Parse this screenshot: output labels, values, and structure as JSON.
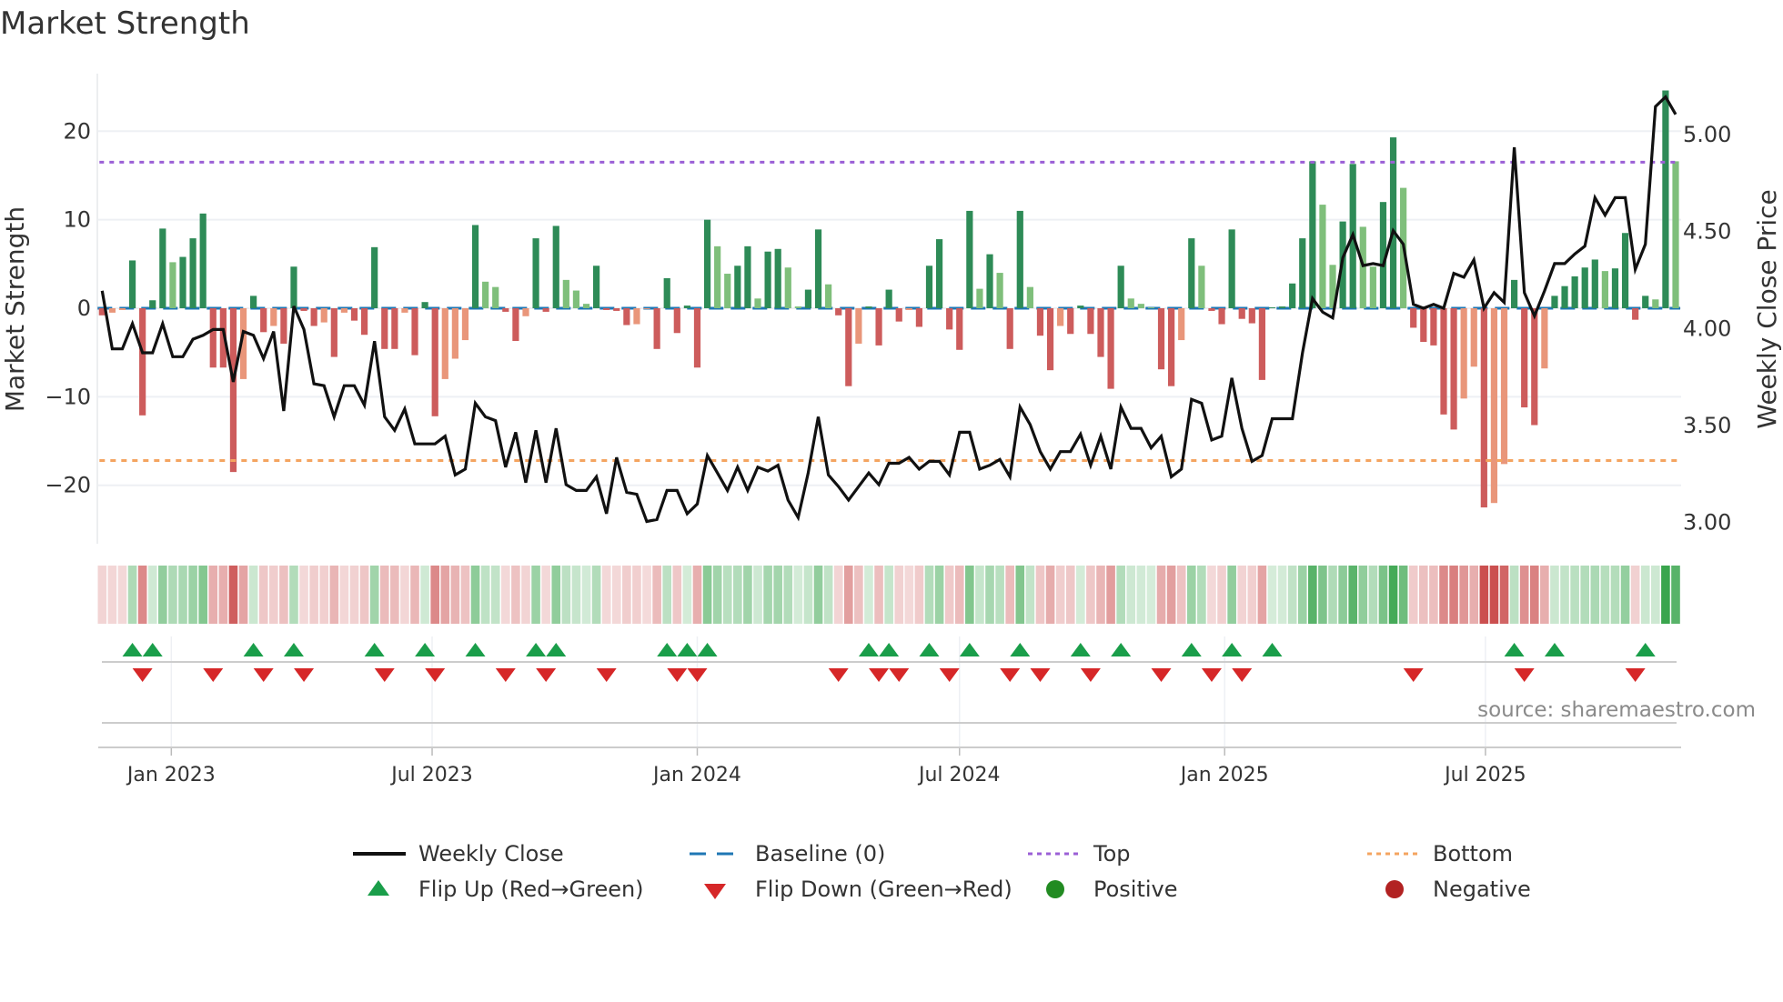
{
  "title": "Market Strength",
  "source": "source: sharemaestro.com",
  "colors": {
    "strong_positive": "#2e8b57",
    "weak_positive": "#7fbf7b",
    "strong_negative": "#cd5c5c",
    "weak_negative": "#e9967a",
    "baseline": "#1f77b4",
    "top": "#9b5fd6",
    "bottom": "#f4a460",
    "close": "#111111",
    "flip_up": "#1a9e4a",
    "flip_down": "#d62728",
    "positive": "#228b22",
    "negative": "#b22222"
  },
  "legend": [
    {
      "label": "Weekly Close",
      "symbol": "solid-line"
    },
    {
      "label": "Baseline (0)",
      "symbol": "dashed-line"
    },
    {
      "label": "Top",
      "symbol": "dotted-line-purple"
    },
    {
      "label": "Bottom",
      "symbol": "dotted-line-orange"
    },
    {
      "label": "Flip Up (Red→Green)",
      "symbol": "triangle-up"
    },
    {
      "label": "Flip Down (Green→Red)",
      "symbol": "triangle-down"
    },
    {
      "label": "Positive",
      "symbol": "circle-green"
    },
    {
      "label": "Negative",
      "symbol": "circle-red"
    }
  ],
  "chart_data": {
    "type": "bar",
    "ylabel": "Market Strength",
    "y2label": "Weekly Close Price",
    "ylim": [
      -26.6,
      26.5
    ],
    "y2lim": [
      2.885,
      5.31
    ],
    "grid": true,
    "legend_position": "bottom",
    "yticks": [
      {
        "value": 20,
        "label": "20"
      },
      {
        "value": 10,
        "label": "10"
      },
      {
        "value": 0,
        "label": "0"
      },
      {
        "value": -10,
        "label": "−10"
      },
      {
        "value": -20,
        "label": "−20"
      }
    ],
    "y2ticks": [
      {
        "value": 5.0,
        "label": "5.00"
      },
      {
        "value": 4.5,
        "label": "4.50"
      },
      {
        "value": 4.0,
        "label": "4.00"
      },
      {
        "value": 3.5,
        "label": "3.50"
      },
      {
        "value": 3.0,
        "label": "3.00"
      }
    ],
    "xticks": [
      {
        "date": "2023-01-01",
        "label": "Jan 2023"
      },
      {
        "date": "2023-07-01",
        "label": "Jul 2023"
      },
      {
        "date": "2024-01-01",
        "label": "Jan 2024"
      },
      {
        "date": "2024-07-01",
        "label": "Jul 2024"
      },
      {
        "date": "2025-01-01",
        "label": "Jan 2025"
      },
      {
        "date": "2025-07-01",
        "label": "Jul 2025"
      }
    ],
    "top_level": 16.5,
    "bottom_level": -17.2,
    "x": [
      "2022-11-14",
      "2022-11-21",
      "2022-11-28",
      "2022-12-05",
      "2022-12-12",
      "2022-12-19",
      "2022-12-26",
      "2023-01-02",
      "2023-01-09",
      "2023-01-16",
      "2023-01-23",
      "2023-01-30",
      "2023-02-06",
      "2023-02-13",
      "2023-02-20",
      "2023-02-27",
      "2023-03-06",
      "2023-03-13",
      "2023-03-20",
      "2023-03-27",
      "2023-04-03",
      "2023-04-10",
      "2023-04-17",
      "2023-04-24",
      "2023-05-01",
      "2023-05-08",
      "2023-05-15",
      "2023-05-22",
      "2023-05-29",
      "2023-06-05",
      "2023-06-12",
      "2023-06-19",
      "2023-06-26",
      "2023-07-03",
      "2023-07-10",
      "2023-07-17",
      "2023-07-24",
      "2023-07-31",
      "2023-08-07",
      "2023-08-14",
      "2023-08-21",
      "2023-08-28",
      "2023-09-04",
      "2023-09-11",
      "2023-09-18",
      "2023-09-25",
      "2023-10-02",
      "2023-10-09",
      "2023-10-16",
      "2023-10-23",
      "2023-10-30",
      "2023-11-06",
      "2023-11-13",
      "2023-11-20",
      "2023-11-27",
      "2023-12-04",
      "2023-12-11",
      "2023-12-18",
      "2023-12-25",
      "2024-01-01",
      "2024-01-08",
      "2024-01-15",
      "2024-01-22",
      "2024-01-29",
      "2024-02-05",
      "2024-02-12",
      "2024-02-19",
      "2024-02-26",
      "2024-03-04",
      "2024-03-11",
      "2024-03-18",
      "2024-03-25",
      "2024-04-01",
      "2024-04-08",
      "2024-04-15",
      "2024-04-22",
      "2024-04-29",
      "2024-05-06",
      "2024-05-13",
      "2024-05-20",
      "2024-05-27",
      "2024-06-03",
      "2024-06-10",
      "2024-06-17",
      "2024-06-24",
      "2024-07-01",
      "2024-07-08",
      "2024-07-15",
      "2024-07-22",
      "2024-07-29",
      "2024-08-05",
      "2024-08-12",
      "2024-08-19",
      "2024-08-26",
      "2024-09-02",
      "2024-09-09",
      "2024-09-16",
      "2024-09-23",
      "2024-09-30",
      "2024-10-07",
      "2024-10-14",
      "2024-10-21",
      "2024-10-28",
      "2024-11-04",
      "2024-11-11",
      "2024-11-18",
      "2024-11-25",
      "2024-12-02",
      "2024-12-09",
      "2024-12-16",
      "2024-12-23",
      "2024-12-30",
      "2025-01-06",
      "2025-01-13",
      "2025-01-20",
      "2025-01-27",
      "2025-02-03",
      "2025-02-10",
      "2025-02-17",
      "2025-02-24",
      "2025-03-03",
      "2025-03-10",
      "2025-03-17",
      "2025-03-24",
      "2025-03-31",
      "2025-04-07",
      "2025-04-14",
      "2025-04-21",
      "2025-04-28",
      "2025-05-05",
      "2025-05-12",
      "2025-05-19",
      "2025-05-26",
      "2025-06-02",
      "2025-06-09",
      "2025-06-16",
      "2025-06-23",
      "2025-06-30",
      "2025-07-07",
      "2025-07-14",
      "2025-07-21",
      "2025-07-28",
      "2025-08-04",
      "2025-08-11",
      "2025-08-18",
      "2025-08-25",
      "2025-09-01",
      "2025-09-08",
      "2025-09-15",
      "2025-09-22",
      "2025-09-29",
      "2025-10-06",
      "2025-10-13",
      "2025-10-20",
      "2025-10-27",
      "2025-11-03",
      "2025-11-10"
    ],
    "series": [
      {
        "name": "Market Strength",
        "axis": "left",
        "type": "bar",
        "values": [
          -0.8,
          -0.5,
          -0.2,
          5.4,
          -12.1,
          0.9,
          9.0,
          5.2,
          5.8,
          7.9,
          10.7,
          -6.7,
          -6.7,
          -18.5,
          -8.0,
          1.4,
          -2.7,
          -2.0,
          -4.0,
          4.7,
          -0.3,
          -2.0,
          -1.6,
          -5.5,
          -0.5,
          -1.4,
          -3.0,
          6.9,
          -4.6,
          -4.6,
          -0.5,
          -5.3,
          0.7,
          -12.2,
          -8.0,
          -5.7,
          -3.6,
          9.4,
          3.0,
          2.4,
          -0.4,
          -3.7,
          -0.9,
          7.9,
          -0.4,
          9.3,
          3.2,
          2.0,
          0.5,
          4.8,
          -0.2,
          -0.3,
          -1.9,
          -1.8,
          -0.1,
          -4.6,
          3.4,
          -2.8,
          0.3,
          -6.7,
          10.0,
          7.0,
          3.9,
          4.8,
          7.0,
          1.1,
          6.4,
          6.7,
          4.6,
          0.2,
          2.1,
          8.9,
          2.7,
          -0.8,
          -8.8,
          -4.0,
          0.2,
          -4.2,
          2.1,
          -1.5,
          -0.2,
          -2.1,
          4.8,
          7.8,
          -2.4,
          -4.7,
          11.0,
          2.2,
          6.1,
          4.0,
          -4.6,
          11.0,
          2.4,
          -3.1,
          -7.0,
          -2.0,
          -2.9,
          0.3,
          -2.9,
          -5.5,
          -9.1,
          4.8,
          1.1,
          0.5,
          0.1,
          -6.9,
          -8.8,
          -3.6,
          7.9,
          4.8,
          -0.3,
          -1.8,
          8.9,
          -1.2,
          -1.7,
          -8.1,
          0.1,
          0.2,
          2.8,
          7.9,
          16.6,
          11.7,
          4.9,
          9.8,
          16.3,
          9.2,
          4.7,
          12.0,
          19.3,
          13.6,
          -2.2,
          -3.8,
          -4.2,
          -12.0,
          -13.7,
          -10.2,
          -6.6,
          -22.5,
          -22.0,
          -17.6,
          3.2,
          -11.2,
          -13.2,
          -6.8,
          1.4,
          2.5,
          3.6,
          4.6,
          5.5,
          4.2,
          4.5,
          8.5,
          -1.3,
          1.4,
          1.0,
          24.6,
          16.6
        ]
      },
      {
        "name": "Weekly Close",
        "axis": "right",
        "type": "line",
        "values": [
          4.19,
          3.89,
          3.89,
          4.02,
          3.87,
          3.87,
          4.02,
          3.85,
          3.85,
          3.94,
          3.96,
          3.99,
          3.99,
          3.72,
          3.98,
          3.96,
          3.84,
          3.98,
          3.57,
          4.11,
          3.99,
          3.71,
          3.7,
          3.54,
          3.7,
          3.7,
          3.6,
          3.93,
          3.54,
          3.47,
          3.58,
          3.4,
          3.4,
          3.4,
          3.44,
          3.24,
          3.27,
          3.61,
          3.54,
          3.52,
          3.28,
          3.46,
          3.2,
          3.47,
          3.2,
          3.48,
          3.19,
          3.16,
          3.16,
          3.23,
          3.04,
          3.33,
          3.15,
          3.14,
          3.0,
          3.01,
          3.16,
          3.16,
          3.04,
          3.09,
          3.34,
          3.25,
          3.16,
          3.28,
          3.16,
          3.28,
          3.26,
          3.29,
          3.11,
          3.02,
          3.25,
          3.54,
          3.24,
          3.18,
          3.11,
          3.18,
          3.25,
          3.19,
          3.3,
          3.3,
          3.33,
          3.27,
          3.31,
          3.31,
          3.24,
          3.46,
          3.46,
          3.27,
          3.29,
          3.32,
          3.23,
          3.59,
          3.5,
          3.36,
          3.27,
          3.36,
          3.36,
          3.45,
          3.29,
          3.44,
          3.27,
          3.59,
          3.48,
          3.48,
          3.38,
          3.44,
          3.23,
          3.27,
          3.63,
          3.61,
          3.42,
          3.44,
          3.74,
          3.48,
          3.31,
          3.34,
          3.53,
          3.53,
          3.53,
          3.87,
          4.15,
          4.08,
          4.05,
          4.36,
          4.48,
          4.32,
          4.33,
          4.32,
          4.5,
          4.43,
          4.12,
          4.1,
          4.12,
          4.1,
          4.28,
          4.26,
          4.35,
          4.1,
          4.18,
          4.13,
          4.93,
          4.18,
          4.06,
          4.19,
          4.33,
          4.33,
          4.38,
          4.42,
          4.67,
          4.58,
          4.67,
          4.67,
          4.3,
          4.43,
          5.14,
          5.19,
          5.1
        ]
      }
    ],
    "flip_up": [
      "2022-12-05",
      "2022-12-19",
      "2023-02-27",
      "2023-03-27",
      "2023-05-22",
      "2023-06-26",
      "2023-07-31",
      "2023-09-11",
      "2023-09-25",
      "2023-12-11",
      "2023-12-25",
      "2024-01-08",
      "2024-04-29",
      "2024-05-13",
      "2024-06-10",
      "2024-07-08",
      "2024-08-12",
      "2024-09-23",
      "2024-10-21",
      "2024-12-09",
      "2025-01-06",
      "2025-02-03",
      "2025-07-21",
      "2025-08-18",
      "2025-10-20"
    ],
    "flip_down": [
      "2022-12-12",
      "2023-01-30",
      "2023-03-06",
      "2023-04-03",
      "2023-05-29",
      "2023-07-03",
      "2023-08-21",
      "2023-09-18",
      "2023-10-30",
      "2023-12-18",
      "2024-01-01",
      "2024-04-08",
      "2024-05-06",
      "2024-05-20",
      "2024-06-24",
      "2024-08-05",
      "2024-08-26",
      "2024-09-30",
      "2024-11-18",
      "2024-12-23",
      "2025-01-13",
      "2025-05-12",
      "2025-07-28",
      "2025-10-13"
    ]
  }
}
